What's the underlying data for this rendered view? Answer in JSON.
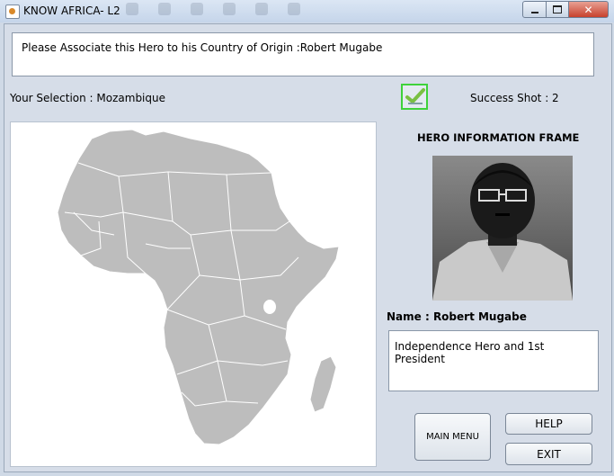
{
  "window": {
    "title": "KNOW AFRICA- L2",
    "close_glyph": "✕",
    "icons": [
      "java-app-icon",
      "minimize-icon",
      "maximize-icon",
      "close-icon"
    ]
  },
  "question": {
    "text": "Please Associate this Hero to his Country of Origin :Robert Mugabe"
  },
  "selection": {
    "text": "Your Selection : Mozambique"
  },
  "status": {
    "icon": "checkmark-icon",
    "success_text": "Success Shot : 2",
    "check_color": "#3fd23b"
  },
  "hero": {
    "frame_title": "HERO INFORMATION FRAME",
    "name_text": "Name : Robert Mugabe",
    "description": "Independence Hero and 1st President"
  },
  "buttons": {
    "main_menu": "MAIN MENU",
    "help": "HELP",
    "exit": "EXIT"
  },
  "colors": {
    "map_fill": "#bdbdbd",
    "map_border": "#ffffff",
    "window_bg": "#d6dde8"
  }
}
